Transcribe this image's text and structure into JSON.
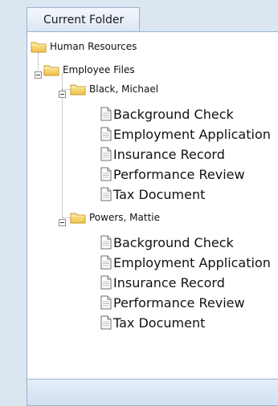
{
  "tab": {
    "title": "Current Folder"
  },
  "tree": {
    "root": "Human Resources",
    "employee_files": "Employee Files",
    "employees": [
      {
        "name": "Black, Michael",
        "documents": [
          "Background Check",
          "Employment Application",
          "Insurance Record",
          "Performance Review",
          "Tax Document"
        ]
      },
      {
        "name": "Powers, Mattie",
        "documents": [
          "Background Check",
          "Employment Application",
          "Insurance Record",
          "Performance Review",
          "Tax Document"
        ]
      }
    ]
  },
  "colors": {
    "folder": "#f5cf5a",
    "panel_border": "#98b2cc",
    "background": "#dce6f0"
  },
  "icons": {
    "folder": "folder-icon",
    "document": "document-icon",
    "expand_toggle": "collapse-toggle-icon"
  }
}
